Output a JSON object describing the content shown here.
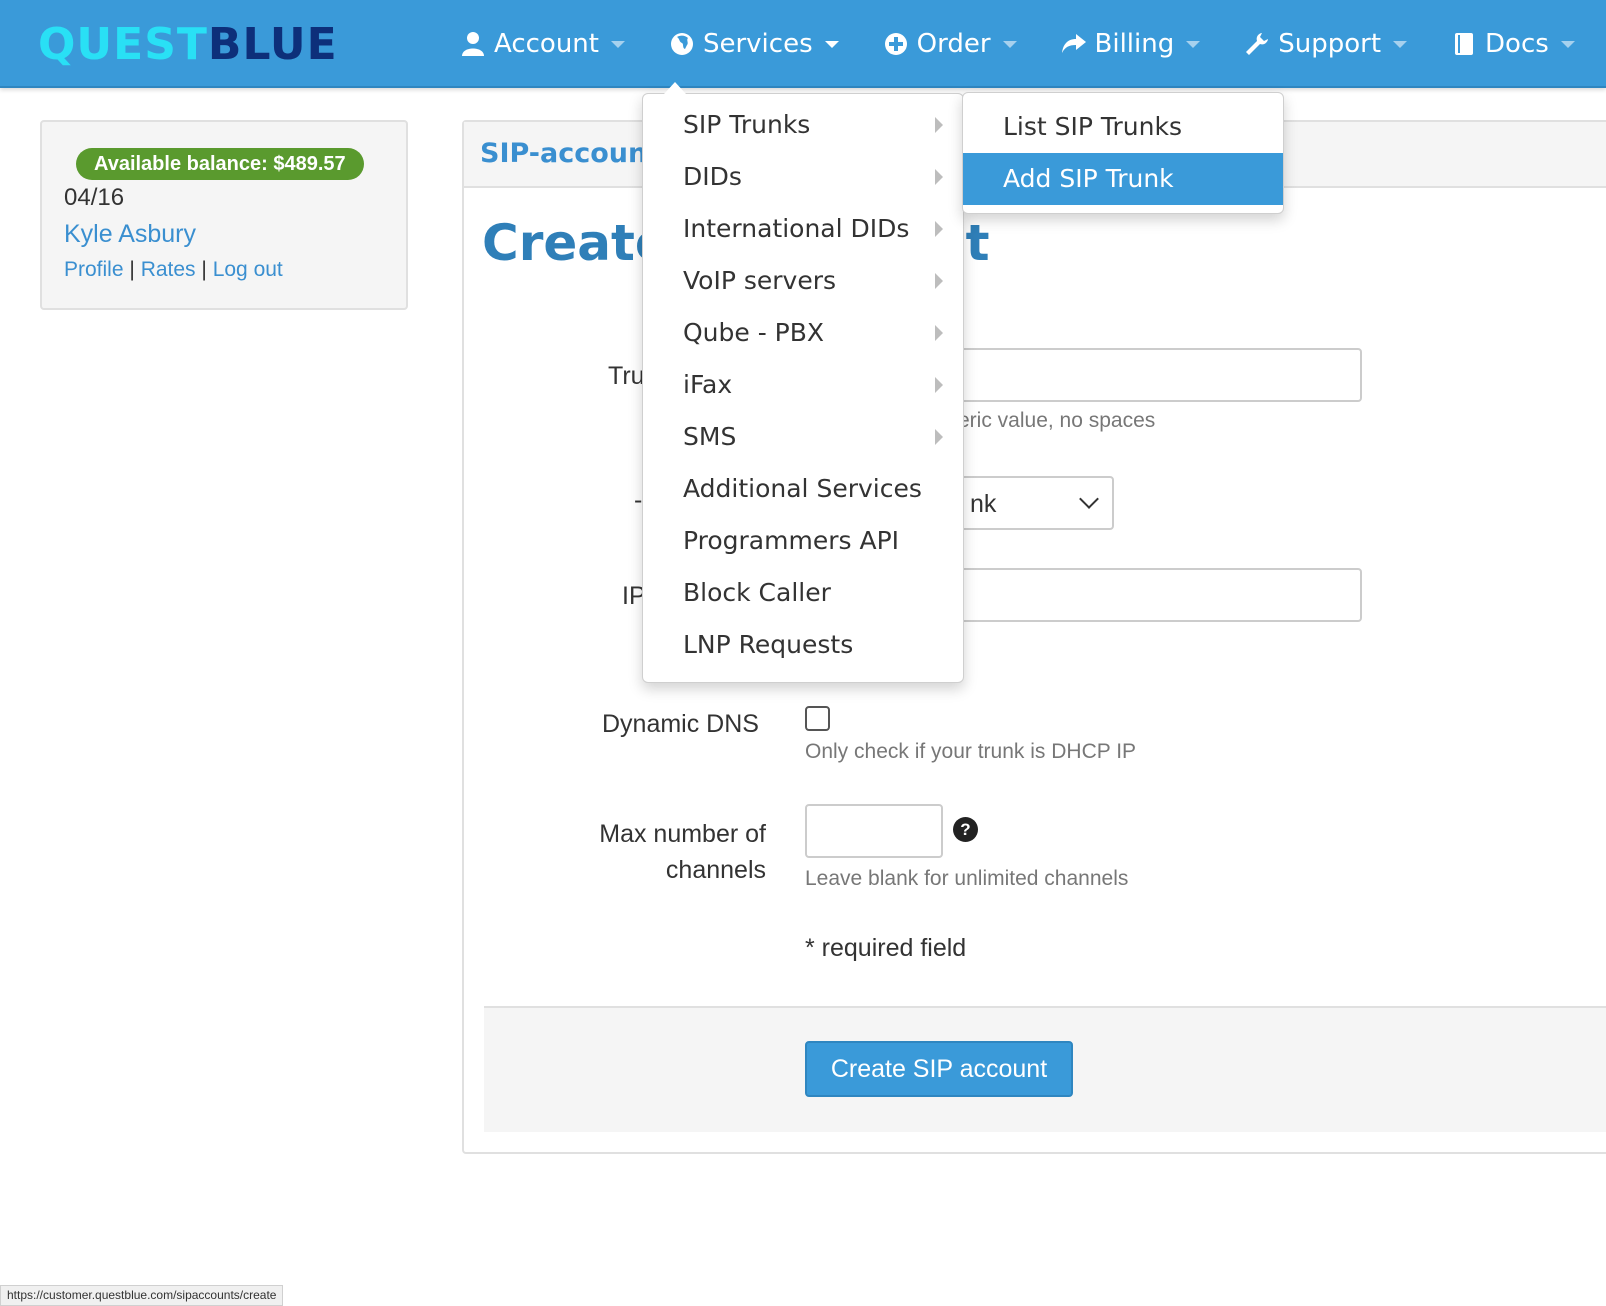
{
  "brand": {
    "part1": "QUEST",
    "part2": "BLUE"
  },
  "colors": {
    "navbar": "#3a9ad9",
    "balance_badge": "#5a9a2e",
    "accent": "#3a9ad9",
    "link": "#3a8fd0",
    "title": "#2f7fb8"
  },
  "nav": [
    {
      "label": "Account",
      "icon": "user-icon"
    },
    {
      "label": "Services",
      "icon": "globe-icon"
    },
    {
      "label": "Order",
      "icon": "plus-circle-icon"
    },
    {
      "label": "Billing",
      "icon": "share-arrow-icon"
    },
    {
      "label": "Support",
      "icon": "wrench-icon"
    },
    {
      "label": "Docs",
      "icon": "book-icon"
    }
  ],
  "user": {
    "balance": "Available balance: $489.57",
    "date": "04/16",
    "name": "Kyle Asbury",
    "links": {
      "profile": "Profile",
      "rates": "Rates",
      "logout": "Log out",
      "sep": "|"
    }
  },
  "panel": {
    "heading": "SIP-accounts"
  },
  "page": {
    "title_left": "Create",
    "title_right": "nt"
  },
  "form": {
    "trunk_label": "Tru",
    "trunk_help": "eric value, no spaces",
    "type_label": "-",
    "type_value": "nk",
    "ip_label": "IP",
    "dyndns_label": "Dynamic DNS",
    "dyndns_help": "Only check if your trunk is DHCP IP",
    "channels_label_1": "Max number of",
    "channels_label_2": "channels",
    "channels_help": "Leave blank for unlimited channels",
    "help_icon": "?",
    "required": "* required field",
    "submit": "Create SIP account"
  },
  "services_menu": [
    {
      "label": "SIP Trunks",
      "submenu": true
    },
    {
      "label": "DIDs",
      "submenu": true
    },
    {
      "label": "International DIDs",
      "submenu": true
    },
    {
      "label": "VoIP servers",
      "submenu": true
    },
    {
      "label": "Qube - PBX",
      "submenu": true
    },
    {
      "label": "iFax",
      "submenu": true
    },
    {
      "label": "SMS",
      "submenu": true
    },
    {
      "label": "Additional Services",
      "submenu": false
    },
    {
      "label": "Programmers API",
      "submenu": false
    },
    {
      "label": "Block Caller",
      "submenu": false
    },
    {
      "label": "LNP Requests",
      "submenu": false
    }
  ],
  "sip_submenu": [
    {
      "label": "List SIP Trunks"
    },
    {
      "label": "Add SIP Trunk"
    }
  ],
  "status_url": "https://customer.questblue.com/sipaccounts/create"
}
